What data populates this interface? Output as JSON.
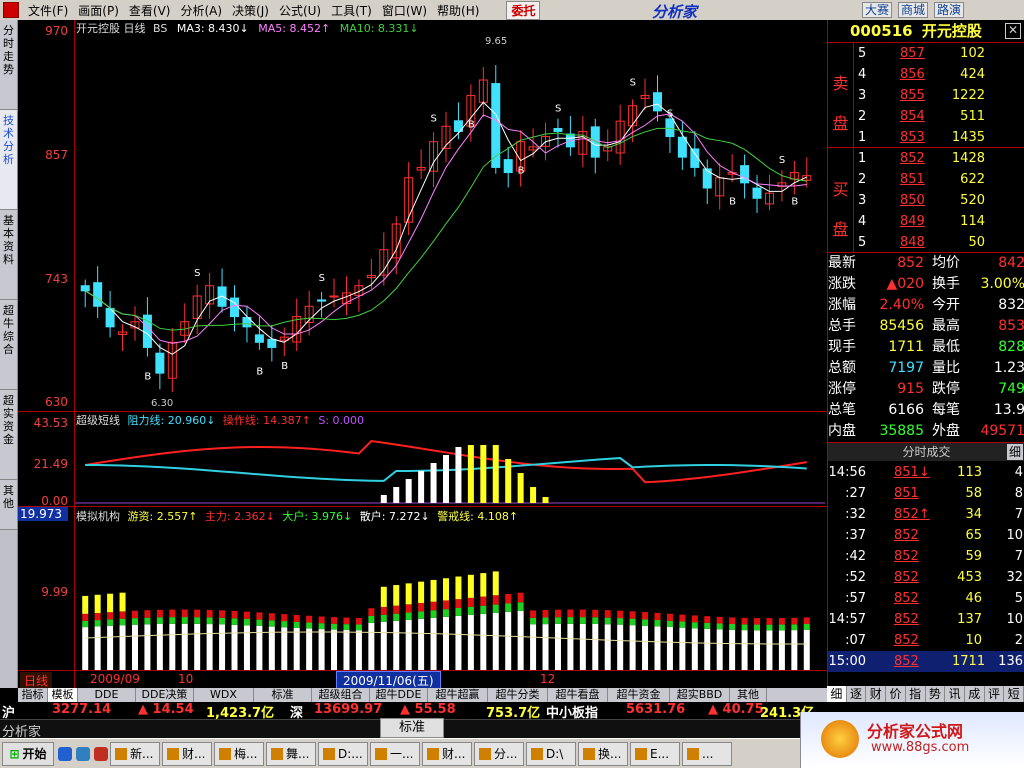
{
  "menubar": {
    "items": [
      "文件(F)",
      "画面(P)",
      "查看(V)",
      "分析(A)",
      "决策(J)",
      "公式(U)",
      "工具(T)",
      "窗口(W)",
      "帮助(H)"
    ],
    "trust": "委托",
    "brand": "分析家",
    "buttons": [
      "大赛",
      "商城",
      "路演"
    ]
  },
  "leftnav": [
    "分时走势",
    "技术分析",
    "基本资料",
    "超牛综合",
    "超实资金",
    "其他"
  ],
  "main": {
    "title": "开元控股 日线",
    "bs": "BS",
    "ma3": "MA3: 8.430↓",
    "ma5": "MA5: 8.452↑",
    "ma10": "MA10: 8.331↓",
    "price_labels": [
      "970",
      "857",
      "743",
      "630"
    ],
    "high_note": "9.65",
    "low_note": "6.30",
    "buy_marker": "B",
    "sell_marker": "S",
    "ind1": {
      "title": "超级短线",
      "resist": "阻力线: 20.960↓",
      "operate": "操作线: 14.387↑",
      "s": "S: 0.000",
      "labels": [
        "43.53",
        "21.49",
        "0.00"
      ]
    },
    "ind2": {
      "sel_value": "19.973",
      "title": "模拟机构",
      "youzi": "游资: 2.557↑",
      "zhuli": "主力: 2.362↓",
      "dahu": "大户: 3.976↓",
      "sanhu": "散户: 7.272↓",
      "alert": "警戒线: 4.108↑",
      "labels": [
        "9.99"
      ]
    },
    "date_row": {
      "period": "日线",
      "d1": "2009/09",
      "d2": "10",
      "cursor": "2009/11/06(五)",
      "d3": "12"
    }
  },
  "bottom_tabs": [
    "指标",
    "模板",
    "DDE",
    "DDE决策",
    "WDX",
    "标准",
    "超级组合",
    "超牛DDE",
    "超牛超赢",
    "超牛分类",
    "超牛看盘",
    "超牛资金",
    "超实BBD",
    "其他"
  ],
  "quote": {
    "code": "000516",
    "name": "开元控股",
    "sell_label": "卖盘",
    "buy_label": "买盘",
    "asks": [
      {
        "lvl": "5",
        "price": "857",
        "vol": "102"
      },
      {
        "lvl": "4",
        "price": "856",
        "vol": "424"
      },
      {
        "lvl": "3",
        "price": "855",
        "vol": "1222"
      },
      {
        "lvl": "2",
        "price": "854",
        "vol": "511"
      },
      {
        "lvl": "1",
        "price": "853",
        "vol": "1435"
      }
    ],
    "bids": [
      {
        "lvl": "1",
        "price": "852",
        "vol": "1428"
      },
      {
        "lvl": "2",
        "price": "851",
        "vol": "622"
      },
      {
        "lvl": "3",
        "price": "850",
        "vol": "520"
      },
      {
        "lvl": "4",
        "price": "849",
        "vol": "114"
      },
      {
        "lvl": "5",
        "price": "848",
        "vol": "50"
      }
    ],
    "stats": [
      {
        "l": "最新",
        "v": "852",
        "c": "red",
        "l2": "均价",
        "v2": "842",
        "c2": "red"
      },
      {
        "l": "涨跌",
        "v": "▲020",
        "c": "red",
        "l2": "换手",
        "v2": "3.00%",
        "c2": "yellow"
      },
      {
        "l": "涨幅",
        "v": "2.40%",
        "c": "red",
        "l2": "今开",
        "v2": "832",
        "c2": "white"
      },
      {
        "l": "总手",
        "v": "85456",
        "c": "yellow",
        "l2": "最高",
        "v2": "853",
        "c2": "red"
      },
      {
        "l": "现手",
        "v": "1711",
        "c": "yellow",
        "l2": "最低",
        "v2": "828",
        "c2": "green"
      },
      {
        "l": "总额",
        "v": "7197",
        "c": "cyan",
        "l2": "量比",
        "v2": "1.23",
        "c2": "white"
      },
      {
        "l": "涨停",
        "v": "915",
        "c": "red",
        "l2": "跌停",
        "v2": "749",
        "c2": "green"
      },
      {
        "l": "总笔",
        "v": "6166",
        "c": "white",
        "l2": "每笔",
        "v2": "13.9",
        "c2": "white"
      },
      {
        "l": "内盘",
        "v": "35885",
        "c": "green",
        "l2": "外盘",
        "v2": "49571",
        "c2": "red"
      }
    ],
    "ticks_header": "分时成交",
    "ticks_btn": "细",
    "ticks": [
      {
        "t": "14:56",
        "p": "851",
        "arrow": "↓",
        "v": "113",
        "n": "4"
      },
      {
        "t": ":27",
        "p": "851",
        "arrow": "",
        "v": "58",
        "n": "8"
      },
      {
        "t": ":32",
        "p": "852",
        "arrow": "↑",
        "v": "34",
        "n": "7"
      },
      {
        "t": ":37",
        "p": "852",
        "arrow": "",
        "v": "65",
        "n": "10"
      },
      {
        "t": ":42",
        "p": "852",
        "arrow": "",
        "v": "59",
        "n": "7"
      },
      {
        "t": ":52",
        "p": "852",
        "arrow": "",
        "v": "453",
        "n": "32"
      },
      {
        "t": ":57",
        "p": "852",
        "arrow": "",
        "v": "46",
        "n": "5"
      },
      {
        "t": "14:57",
        "p": "852",
        "arrow": "",
        "v": "137",
        "n": "10"
      },
      {
        "t": ":07",
        "p": "852",
        "arrow": "",
        "v": "10",
        "n": "2"
      },
      {
        "t": "15:00",
        "p": "852",
        "arrow": "",
        "v": "1711",
        "n": "136"
      }
    ],
    "rtabs": [
      "细",
      "逐",
      "财",
      "价",
      "指",
      "势",
      "讯",
      "成",
      "评",
      "短"
    ]
  },
  "ticker": {
    "sh_label": "沪",
    "sh_index": "3277.14",
    "sh_chg": "▲ 14.54",
    "sh_amt": "1,423.7亿",
    "sz_label": "深",
    "sz_index": "13699.97",
    "sz_chg": "▲ 55.58",
    "sz_amt": "753.7亿",
    "zx_label": "中小板指",
    "zx_index": "5631.76",
    "zx_chg": "▲ 40.75",
    "zx_amt": "241.3亿",
    "app_label": "分析家",
    "std_btn": "标准"
  },
  "taskbar": {
    "start": "开始",
    "tasks": [
      "新...",
      "财...",
      "梅...",
      "舞...",
      "D:...",
      "一...",
      "财...",
      "分...",
      "D:\\",
      "换...",
      "E...",
      "..."
    ]
  },
  "watermark": {
    "site": "分析家公式网",
    "url": "www.88gs.com"
  },
  "colors": {
    "up": "#ff3030",
    "down": "#40e0ff",
    "ma3": "#ffffff",
    "ma5": "#ff80ff",
    "ma10": "#40d040"
  }
}
